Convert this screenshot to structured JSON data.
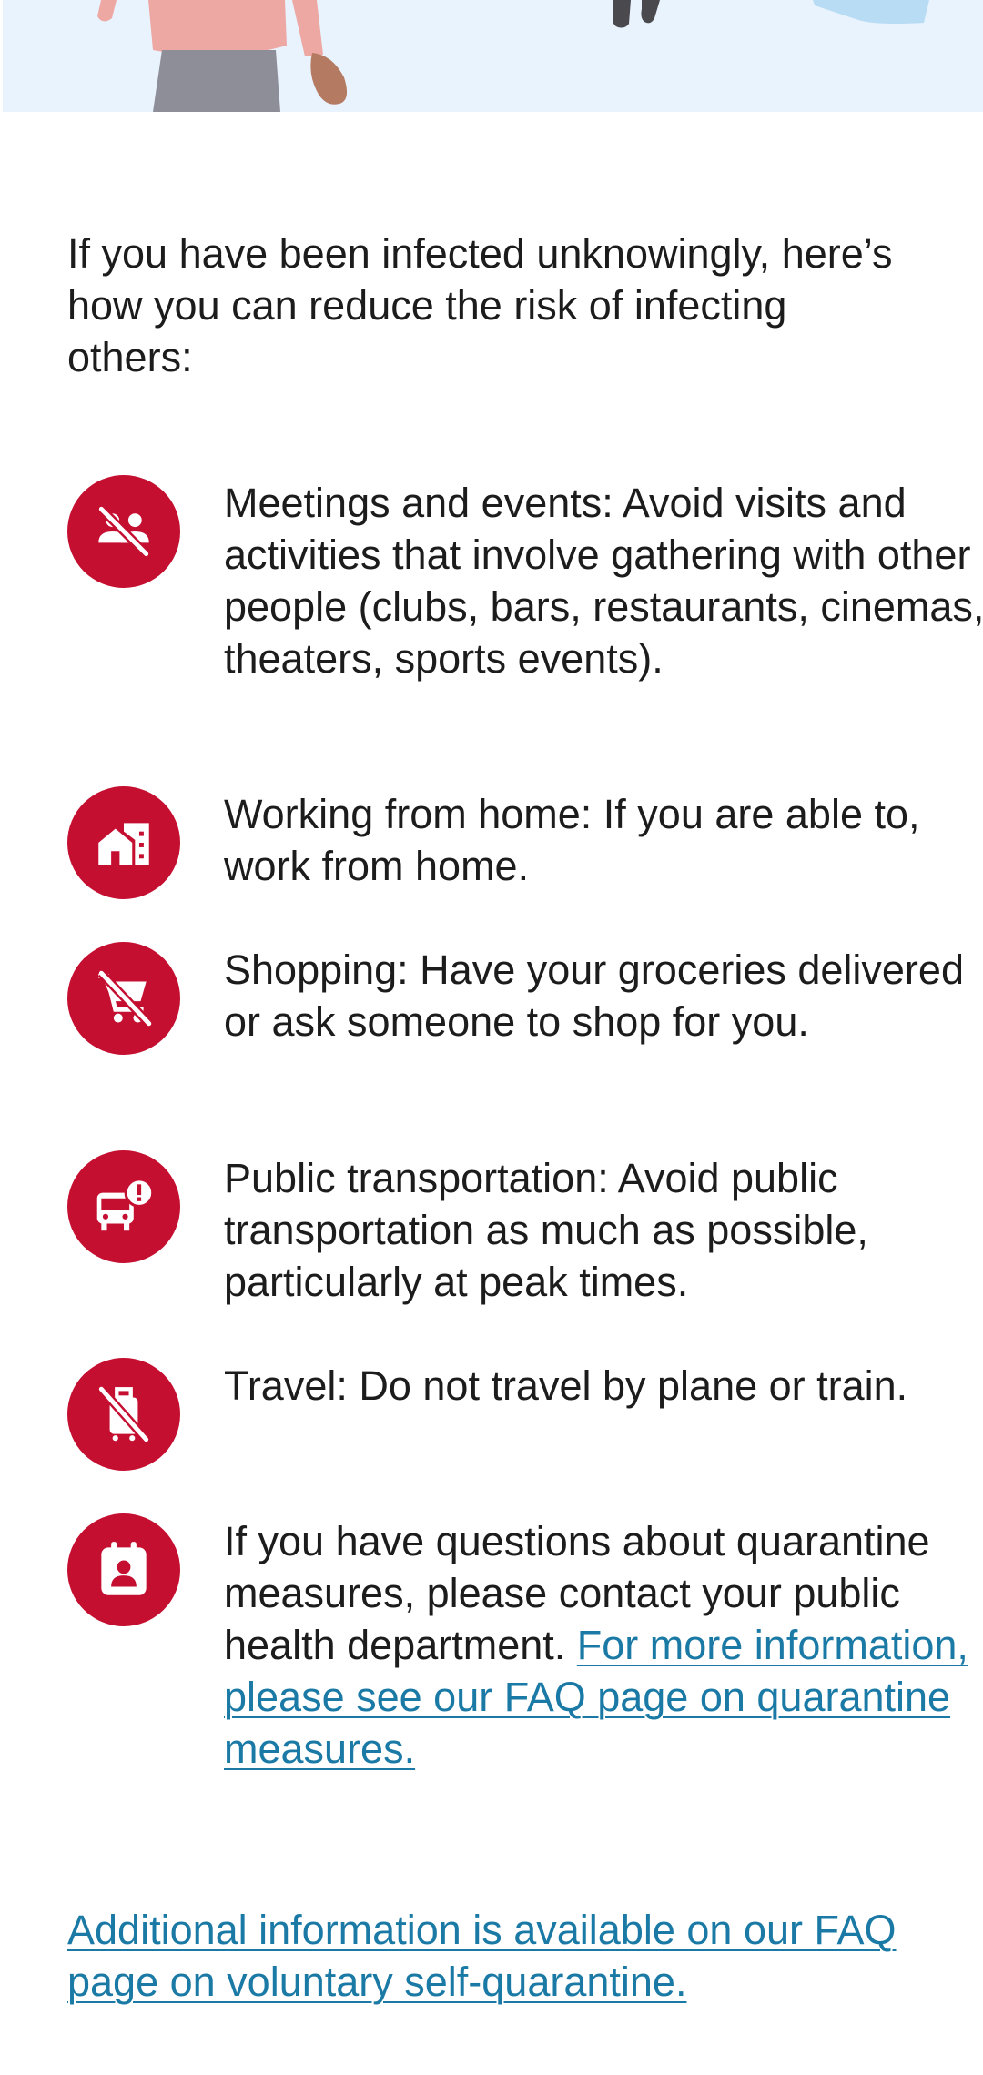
{
  "intro_text": "If you have been infected unknowingly, here’s how you can reduce the risk of infecting others:",
  "measures": [
    {
      "icon": "no-gathering-icon",
      "text": "Meetings and events: Avoid visits and activities that involve gathering with other people (clubs, bars, restaurants, cinemas, theaters, sports events)."
    },
    {
      "icon": "home-office-icon",
      "text": "Working from home: If you are able to, work from home."
    },
    {
      "icon": "no-shopping-cart-icon",
      "text": "Shopping: Have your groceries delivered or ask someone to shop for you."
    },
    {
      "icon": "bus-warning-icon",
      "text": "Public transportation: Avoid public transportation as much as possible, particularly at peak times."
    },
    {
      "icon": "no-luggage-icon",
      "text": "Travel: Do not travel by plane or train."
    },
    {
      "icon": "contact-card-icon",
      "text": "If you have questions about quarantine measures, please contact your public health department. ",
      "link_text": "For more information, please see our FAQ page on quarantine measures."
    }
  ],
  "footer_link": "Additional information is available on our FAQ page on voluntary self-quarantine.",
  "colors": {
    "accent": "#c50f31",
    "link": "#1a7aa5",
    "banner_bg": "#e8f3fd",
    "text": "#1c1c1c"
  }
}
